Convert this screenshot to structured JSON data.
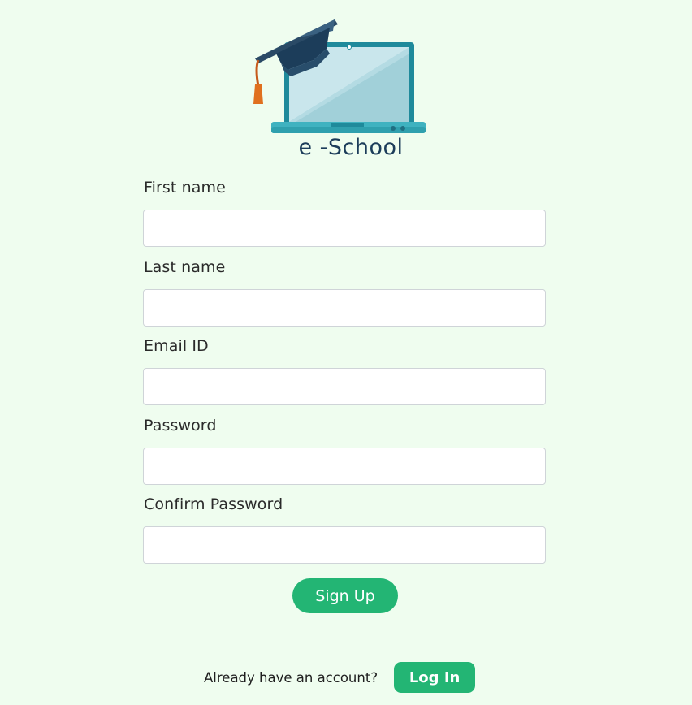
{
  "logo": {
    "icon": "graduation-cap-laptop-icon",
    "text": "e -School"
  },
  "form": {
    "fields": [
      {
        "label": "First name",
        "value": "",
        "placeholder": ""
      },
      {
        "label": "Last name",
        "value": "",
        "placeholder": ""
      },
      {
        "label": "Email ID",
        "value": "",
        "placeholder": ""
      },
      {
        "label": "Password",
        "value": "",
        "placeholder": ""
      },
      {
        "label": "Confirm Password",
        "value": "",
        "placeholder": ""
      }
    ],
    "signup_label": "Sign Up"
  },
  "footer": {
    "prompt": "Already have an account?",
    "login_label": "Log In"
  },
  "colors": {
    "background": "#effdef",
    "accent": "#23b574",
    "logo_text": "#1c3d5a"
  }
}
